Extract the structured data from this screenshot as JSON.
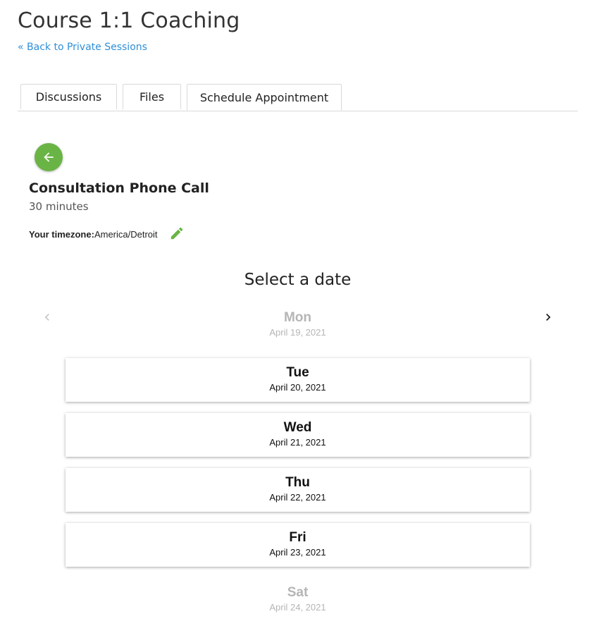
{
  "header": {
    "title": "Course 1:1 Coaching",
    "back_link": "« Back to Private Sessions"
  },
  "tabs": [
    {
      "label": "Discussions",
      "active": false
    },
    {
      "label": "Files",
      "active": false
    },
    {
      "label": "Schedule Appointment",
      "active": true
    }
  ],
  "event": {
    "back_icon": "arrow-left-icon",
    "title": "Consultation Phone Call",
    "duration": "30 minutes",
    "timezone_label": "Your timezone:",
    "timezone_value": "America/Detroit",
    "edit_icon": "pencil-icon"
  },
  "picker": {
    "title": "Select a date",
    "prev_icon": "chevron-left-icon",
    "next_icon": "chevron-right-icon",
    "days": [
      {
        "name": "Mon",
        "date": "April 19, 2021",
        "available": false
      },
      {
        "name": "Tue",
        "date": "April 20, 2021",
        "available": true
      },
      {
        "name": "Wed",
        "date": "April 21, 2021",
        "available": true
      },
      {
        "name": "Thu",
        "date": "April 22, 2021",
        "available": true
      },
      {
        "name": "Fri",
        "date": "April 23, 2021",
        "available": true
      },
      {
        "name": "Sat",
        "date": "April 24, 2021",
        "available": false
      }
    ]
  },
  "colors": {
    "accent": "#6ab446",
    "link": "#2f8fd8",
    "disabled_text": "#b5b5b5"
  }
}
